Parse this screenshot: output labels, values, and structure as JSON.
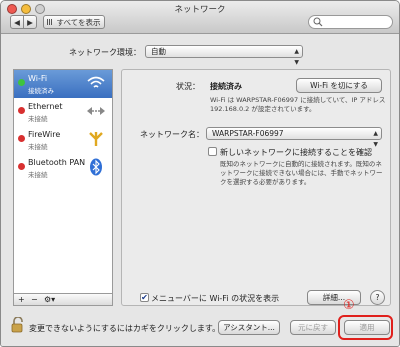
{
  "window": {
    "title": "ネットワーク",
    "show_all_label": "すべてを表示"
  },
  "location": {
    "label": "ネットワーク環境：",
    "value": "自動"
  },
  "services": [
    {
      "name": "Wi-Fi",
      "status": "接続済み",
      "dot_color": "#3ec43e",
      "icon": "wifi-icon",
      "selected": true
    },
    {
      "name": "Ethernet",
      "status": "未接続",
      "dot_color": "#d83030",
      "icon": "ethernet-icon",
      "selected": false
    },
    {
      "name": "FireWire",
      "status": "未接続",
      "dot_color": "#d83030",
      "icon": "firewire-icon",
      "selected": false
    },
    {
      "name": "Bluetooth PAN",
      "status": "未接続",
      "dot_color": "#d83030",
      "icon": "bluetooth-icon",
      "selected": false
    }
  ],
  "sidebar_tools": {
    "add": "+",
    "remove": "−",
    "gear": "⚙▾"
  },
  "status": {
    "label": "状況：",
    "value": "接続済み",
    "toggle_button": "Wi-Fi を切にする",
    "description": "Wi-Fi は WARPSTAR-F06997 に接続していて、IP アドレス 192.168.0.2 が設定されています。"
  },
  "network_name": {
    "label": "ネットワーク名：",
    "value": "WARPSTAR-F06997"
  },
  "ask_join": {
    "label": "新しいネットワークに接続することを確認",
    "checked": false,
    "description": "既知のネットワークに自動的に接続されます。既知のネットワークに接続できない場合には、手動でネットワークを選択する必要があります。"
  },
  "menu_bar": {
    "label": "メニューバーに Wi-Fi の状況を表示",
    "checked": true
  },
  "buttons": {
    "advanced": "詳細...",
    "help": "?",
    "assistant": "アシスタント...",
    "revert": "元に戻す",
    "apply": "適用"
  },
  "lock_text": "変更できないようにするにはカギをクリックします。",
  "annotation": {
    "number": "①",
    "color": "#e0201c"
  }
}
